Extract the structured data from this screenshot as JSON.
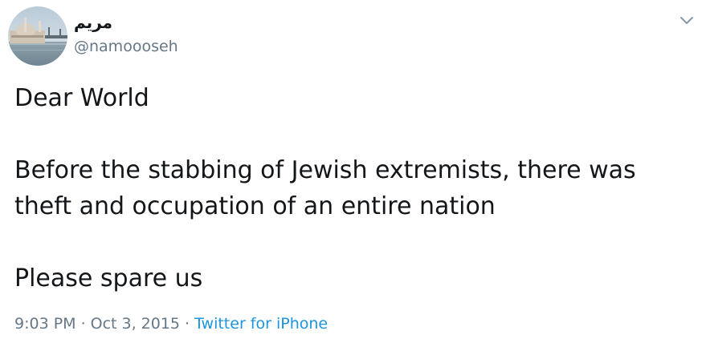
{
  "user": {
    "display_name": "مريم",
    "handle": "@namoooseh",
    "avatar_icon": "avatar-photo-mosque-waterfront"
  },
  "menu": {
    "icon": "chevron-down-icon"
  },
  "tweet": {
    "lines": [
      "Dear World",
      "",
      "Before the stabbing of Jewish extremists, there was",
      "theft and occupation of an entire nation",
      "",
      "Please spare us"
    ]
  },
  "meta": {
    "time": "9:03 PM",
    "separator": "·",
    "date": "Oct 3, 2015",
    "source": "Twitter for iPhone"
  },
  "colors": {
    "text": "#14171a",
    "secondary": "#657786",
    "link": "#1b95e0",
    "background": "#ffffff"
  }
}
